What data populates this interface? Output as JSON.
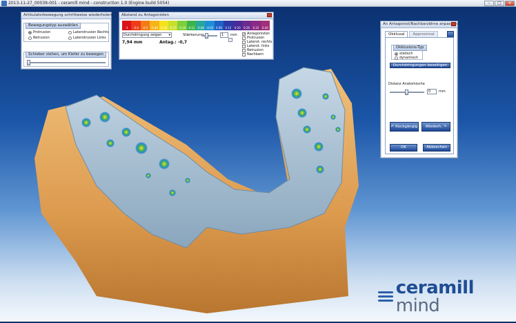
{
  "window": {
    "title": "2013-11-27_00039-001 - ceramill mind - construction 1.0 (Engine build 5054)"
  },
  "articulator_panel": {
    "title": "Artikulatorbewegung schrittweise wiederholen",
    "group_title": "Bewegungstyp auswählen",
    "options": [
      "Protrusion",
      "Laterotrusion Rechts",
      "Retrusion",
      "Laterotrusion Links"
    ],
    "selected": "Protrusion",
    "slider_title": "Schieber ziehen, um Kiefer zu bewegen",
    "slider_value": 0
  },
  "distance_panel": {
    "title": "Abstand zu Antagonisten",
    "scale_colors": [
      "#d9141b",
      "#ee3b1a",
      "#f47a18",
      "#f8b419",
      "#f5e21b",
      "#c9e02a",
      "#7fcf3a",
      "#3ab44a",
      "#26a79b",
      "#1e8fd6",
      "#2160c6",
      "#2b3aa8",
      "#4a2a98",
      "#6a2a8e",
      "#8a2a84",
      "#a0307a"
    ],
    "scale_labels": [
      "-1",
      "-0.6",
      "-0.5",
      "-0.44",
      "-0.36",
      "-0.27",
      "-0.19",
      "-0.12",
      "-0.08",
      "-0.02",
      "0.06",
      "0.12",
      "0.20",
      "0.26",
      "0.32",
      "0.40"
    ],
    "dropdown_value": "Durchdringung zeigen",
    "value_mm": "7,94 mm",
    "antag_label": "Antag.: -0,7",
    "strength_label": "Stärkerung",
    "strength_value": "1",
    "strength_unit": "mm",
    "checks": [
      {
        "label": "Antagonisten",
        "checked": true
      },
      {
        "label": "Protrusion",
        "checked": false
      },
      {
        "label": "Laterot. rechts",
        "checked": false
      },
      {
        "label": "Laterot. links",
        "checked": false
      },
      {
        "label": "Retrusion",
        "checked": false
      },
      {
        "label": "Nachbarn",
        "checked": false
      }
    ]
  },
  "adjust_panel": {
    "title": "An Antagonist/Nachbarzähne anpassen",
    "tabs": [
      "Okklusal",
      "Approximal"
    ],
    "active_tab": "Okklusal",
    "occlusion_group": "Okklusions-Typ",
    "occlusion_options": [
      "statisch",
      "dynamisch"
    ],
    "occlusion_selected": "statisch",
    "remove_button": "Durchdringungen beseitigen",
    "distance_label": "Distanz Anatomische",
    "distance_value": "0",
    "distance_unit": "mm",
    "back_button": "Rückgängig",
    "redo_button": "Wiederh.",
    "ok_button": "OK",
    "cancel_button": "Abbrechen"
  },
  "branding": {
    "logo_part1": "ceramill",
    "logo_part2": "mind"
  },
  "colors": {
    "background_top": "#0a2f6e",
    "stone": "#e3a35a",
    "tooth": "#a9c2d6",
    "accent": "#1d4796"
  }
}
